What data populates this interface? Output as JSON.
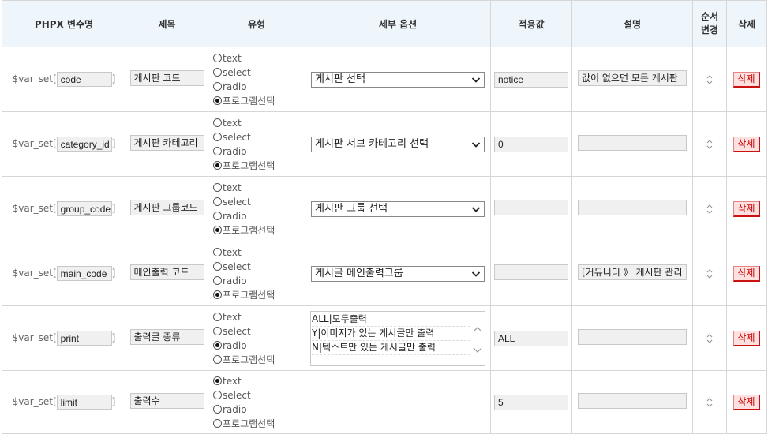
{
  "headers": {
    "var": "PHPX 변수명",
    "title": "제목",
    "type": "유형",
    "options": "세부 옵션",
    "value": "적용값",
    "desc": "설명",
    "order_l1": "순서",
    "order_l2": "변경",
    "delete": "삭제"
  },
  "var_prefix": "$var_set[",
  "var_suffix": "]",
  "type_labels": [
    "text",
    "select",
    "radio",
    "프로그램선택"
  ],
  "delete_label": "삭제",
  "rows": [
    {
      "var": "code",
      "title": "게시판 코드",
      "selected_type": "프로그램선택",
      "option": "게시판 선택",
      "value": "notice",
      "desc": "값이 없으면 모든 게시판"
    },
    {
      "var": "category_id",
      "title": "게시판 카테고리",
      "selected_type": "프로그램선택",
      "option": "게시판 서브 카테고리 선택",
      "value": "0",
      "desc": ""
    },
    {
      "var": "group_code",
      "title": "게시판 그룹코드",
      "selected_type": "프로그램선택",
      "option": "게시판 그룹 선택",
      "value": "",
      "desc": ""
    },
    {
      "var": "main_code",
      "title": "메인출력 코드",
      "selected_type": "프로그램선택",
      "option": "게시글 메인출력그룹",
      "value": "",
      "desc": "[커뮤니티 》 게시판 관리"
    },
    {
      "var": "print",
      "title": "출력글 종류",
      "selected_type": "radio",
      "option_lines": [
        "ALL|모두출력",
        "Y|이미지가 있는 게시글만 출력",
        "N|텍스트만 있는 게시글만 출력"
      ],
      "value": "ALL",
      "desc": ""
    },
    {
      "var": "limit",
      "title": "출력수",
      "selected_type": "text",
      "value": "5",
      "desc": ""
    }
  ]
}
